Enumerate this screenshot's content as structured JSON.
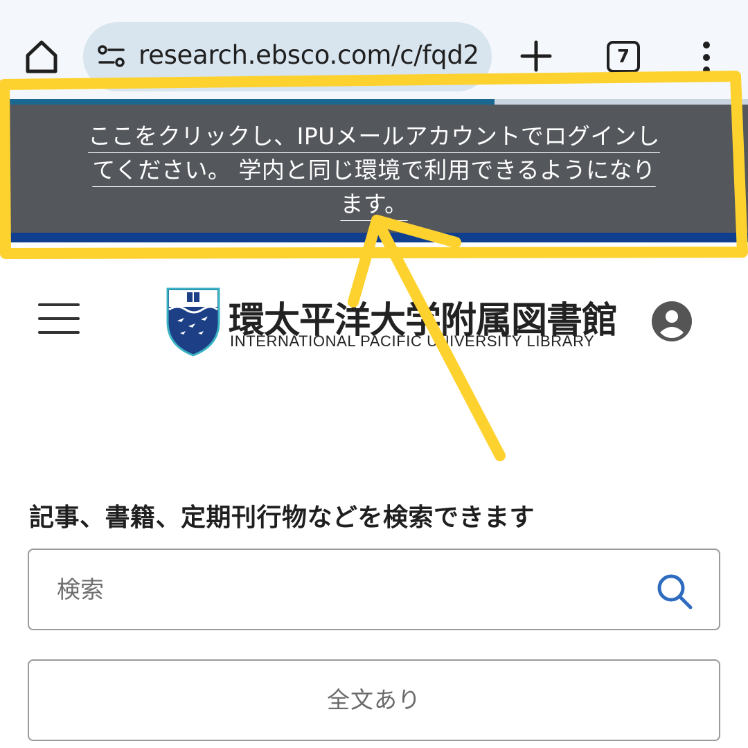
{
  "browser": {
    "url": "research.ebsco.com/c/fqd2",
    "tab_count": "7"
  },
  "banner": {
    "lines": [
      "ここをクリックし、IPUメールアカウントでログインし",
      "てください。 学内と同じ環境で利用できるようになり",
      "ます。"
    ]
  },
  "header": {
    "logo_title": "環太平洋大学附属図書館",
    "logo_subtitle": "INTERNATIONAL PACIFIC UNIVERSITY LIBRARY"
  },
  "search": {
    "heading": "記事、書籍、定期刊行物などを検索できます",
    "placeholder": "検索",
    "fulltext_label": "全文あり"
  },
  "colors": {
    "banner_bg": "#54575c",
    "banner_strip": "#0f3f8e",
    "annotation_highlight": "#fdd22f",
    "search_icon": "#2f6cc0"
  }
}
